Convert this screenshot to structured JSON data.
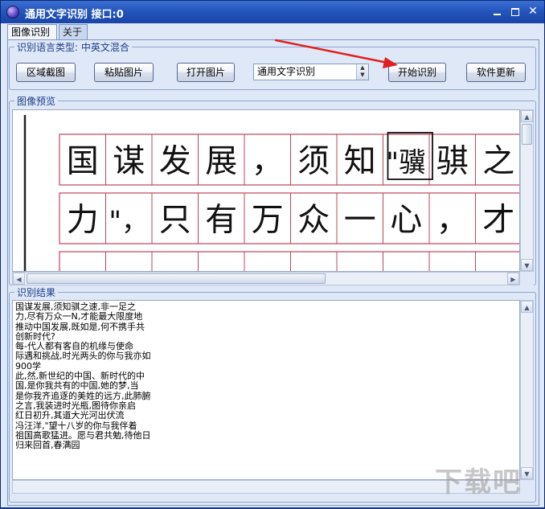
{
  "window": {
    "title": "通用文字识别 接口:0",
    "minimize": "_",
    "maximize": "□",
    "close": "✕"
  },
  "tabs": [
    {
      "label": "图像识别",
      "active": true
    },
    {
      "label": "关于",
      "active": false
    }
  ],
  "lang_group": {
    "legend": "识别语言类型: 中英文混合"
  },
  "toolbar": {
    "capture_label": "区域截图",
    "paste_label": "粘贴图片",
    "open_label": "打开图片",
    "engine_selected": "通用文字识别",
    "start_label": "开始识别",
    "update_label": "软件更新"
  },
  "preview_group": {
    "legend": "图像预览",
    "rows": [
      [
        "国",
        "谋",
        "发",
        "展",
        "，",
        "须",
        "知",
        "\"骥",
        "骐",
        "之"
      ],
      [
        "力",
        "\"，",
        "只",
        "有",
        "万",
        "众",
        "一",
        "心",
        "，",
        "才"
      ],
      [
        "",
        "",
        "",
        "",
        "",
        "",
        "",
        "",
        "",
        ""
      ]
    ]
  },
  "result_group": {
    "legend": "识别结果",
    "text": "国谋发展,须知骐之速,非一足之\n力,尽有万众一N,才能最大限度地\n推动中国发展,既如是,何不携手共\n创新时代?\n每-代人都有客自的机缘与使命\n际遇和挑战,时光两头的你与我亦如\n900学\n此,然,新世纪的中国、新时代的中\n国,是你我共有的中国,她的梦,当\n是你我齐追逐的美姓的远方,此肺腑\n之言,我装进时光瓶,图待你亲启\n红日初升,其道大光河出伏流\n冯汪洋,\"望十八岁的你与我伴着\n祖国高歌猛进。愿与君共勉,待他日\n归来回首,春满园"
  },
  "watermark": "下载吧",
  "colors": {
    "title_bar": "#2456bd",
    "arrow": "#e02020",
    "grid_line": "#c0445a"
  }
}
